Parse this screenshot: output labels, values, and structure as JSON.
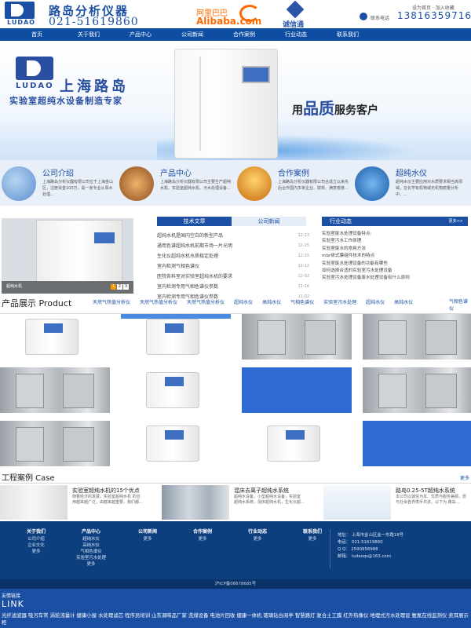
{
  "header": {
    "logo_text": "LUDAO",
    "company": "路岛分析仪器",
    "phone": "021-51619860",
    "alibaba_cn": "阿里巴巴",
    "alibaba_en": "Alibaba.com",
    "chengxin": "诚信通",
    "top_links": "设为首页 · 加入收藏",
    "tel_label": "联系电话",
    "tel_number": "13816359716"
  },
  "nav": [
    "首页",
    "关于我们",
    "产品中心",
    "公司新闻",
    "合作案例",
    "行业动态",
    "联系我们"
  ],
  "banner": {
    "logo": "LUDAO",
    "title": "上海路岛",
    "subtitle": "实验室超纯水设备制造专家",
    "slogan_pre": "用",
    "slogan_big": "品质",
    "slogan_post": "服务客户"
  },
  "intro": [
    {
      "title": "公司介绍",
      "text": "上海路岛分析仪器有限公司位于上海金山区，注册资金100万，是一家专业从事水处理..."
    },
    {
      "title": "产品中心",
      "text": "上海路岛分析仪器有限公司主要生产超纯水机、实验室超纯水机、污水处理设备..."
    },
    {
      "title": "合作案例",
      "text": "上海路岛分析仪器有限公司合成立以来先后合作国内多家企业、院校、满意者度..."
    },
    {
      "title": "超纯水仪",
      "text": "超纯水仪主要应用对水质要求相当高领域，在化学有机物或无机物痕量分析中、..."
    }
  ],
  "news": {
    "photo_caption": "超纯水机",
    "pages": [
      "1",
      "2",
      "3"
    ],
    "tabs": [
      "技术文章",
      "公司新闻"
    ],
    "items": [
      {
        "title": "超纯水机是国内空白的新型产品",
        "date": "12-23"
      },
      {
        "title": "通用色谱超纯水机前期市场一片光明",
        "date": "12-15"
      },
      {
        "title": "生化仪超纯水机水质稳定处理",
        "date": "12-15"
      },
      {
        "title": "室内检测气相色谱仪",
        "date": "12-12"
      },
      {
        "title": "医院各科室对实验室超纯水机的要求",
        "date": "12-02"
      },
      {
        "title": "室内检测专用气相色谱仪参数",
        "date": "11-16"
      },
      {
        "title": "室内检测专用气相色谱仪参数",
        "date": "11-02"
      }
    ],
    "industry_title": "行业动态",
    "industry_more": "更多>>",
    "industry_items": [
      "实验室废水处理设备特点:",
      "实验室污水工作原理",
      "实验室废水的常用方法",
      "mbr研式膜组件技术的特点",
      "实验室废水处理设备的功能有哪些",
      "如何选择合适的实验室污水处理设备",
      "实验室污水处理设备废水处理设备有什么原则"
    ]
  },
  "products": {
    "title": "产品展示 Product",
    "categories": [
      "天然气热值分析仪",
      "天然气热值分析仪",
      "天然气热值分析仪",
      "超纯水仪",
      "高纯水仪",
      "气相色谱仪",
      "实验室污水处理",
      "超纯水仪",
      "高纯水仪"
    ],
    "last_category": "气相色谱仪",
    "rows": [
      [
        "wm",
        "wm-blue",
        "steel",
        "steel"
      ],
      [
        "steel",
        "wm",
        "blue",
        "steel"
      ],
      [
        "steel",
        "wm",
        "wm",
        "blue"
      ]
    ]
  },
  "cases": {
    "title": "工程案例 Case",
    "more": "更多",
    "items": [
      {
        "title": "实验室超纯水机的15个优点",
        "text": "随着经济的发展，实验室超纯水机 的应用越来越广泛，由越来越重要，我们都..."
      },
      {
        "title": "混床去离子超纯水系统",
        "text": "超纯水设备，小型超纯水设备，实验室 超纯水系统，混床超纯水机，生化仪超..."
      },
      {
        "title": "路岛0.25-5T超纯水系统",
        "text": "本公司以诚信为本、优质与服务兼顾，愿与社会各界携手共进，以下为 路岛..."
      }
    ]
  },
  "footer": {
    "columns": [
      {
        "title": "关于我们",
        "items": [
          "公司介绍",
          "企业文化",
          "更多"
        ]
      },
      {
        "title": "产品中心",
        "items": [
          "超纯水仪",
          "高纯水仪",
          "气相色谱仪",
          "实验室污水处理",
          "更多"
        ]
      },
      {
        "title": "公司新闻",
        "items": [
          "更多"
        ]
      },
      {
        "title": "合作案例",
        "items": [
          "更多"
        ]
      },
      {
        "title": "行业动态",
        "items": [
          "更多"
        ]
      },
      {
        "title": "联系我们",
        "items": [
          "更多"
        ]
      }
    ],
    "contact": [
      "地址： 上海市金山区金一东路18号",
      "电话： 021-51619860",
      "Q Q： 2590956988",
      "邮箱： ludaoqs@163.com"
    ],
    "copyright": "沪ICP备06678685号"
  },
  "links": {
    "cn": "友情链接",
    "en": "LINK",
    "text": "光纤滤波器 吸污车常 涡轮流量计 健康小屋 水处理滤芯 程序员培训 山东调味品厂家 洗煤设备 电池片回收 健康一体机 玻璃钻台阅亭 智慧路灯 复合土工膜 红外热像仪 地埋式污水处理设 氨氮在线监测仪 卖耳展示柜"
  }
}
